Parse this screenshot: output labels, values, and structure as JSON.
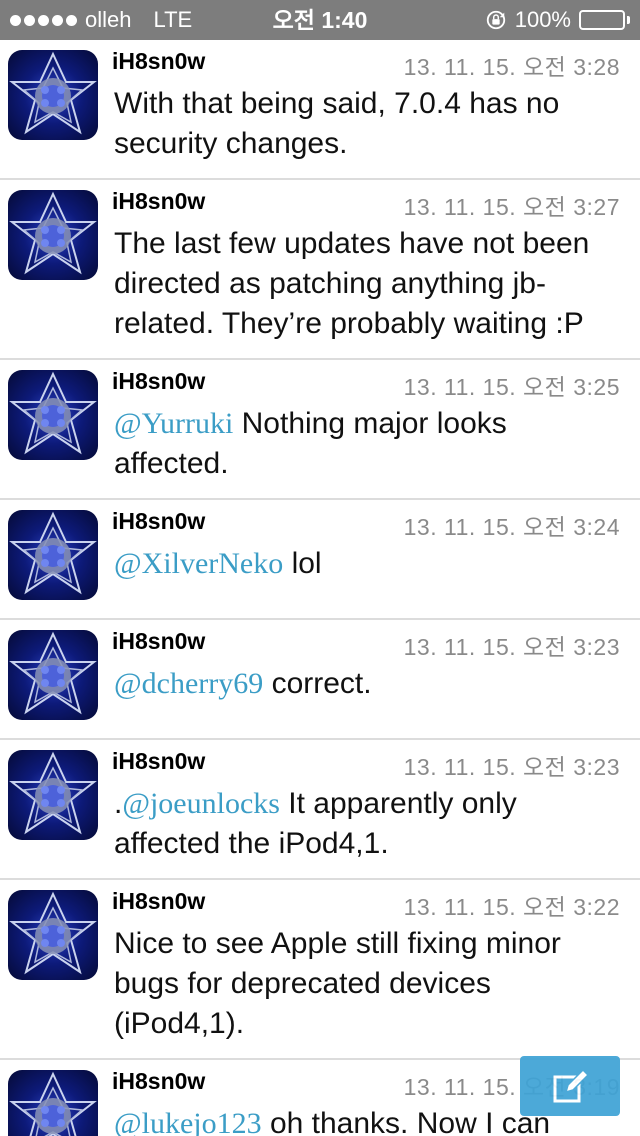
{
  "status_bar": {
    "carrier": "olleh",
    "network": "LTE",
    "time": "오전 1:40",
    "battery": "100%",
    "battery_level": 1.0,
    "signal_bars": 5
  },
  "tweets": [
    {
      "author": "iH8sn0w",
      "timestamp": "13. 11. 15. 오전 3:28",
      "prefix": "",
      "mention": "",
      "text": "With that being said, 7.0.4 has no security changes."
    },
    {
      "author": "iH8sn0w",
      "timestamp": "13. 11. 15. 오전 3:27",
      "prefix": "",
      "mention": "",
      "text": "The last few updates have not been directed as patching anything jb-related. They’re probably waiting :P"
    },
    {
      "author": "iH8sn0w",
      "timestamp": "13. 11. 15. 오전 3:25",
      "prefix": "",
      "mention": "@Yurruki",
      "text": " Nothing major looks affected."
    },
    {
      "author": "iH8sn0w",
      "timestamp": "13. 11. 15. 오전 3:24",
      "prefix": "",
      "mention": "@XilverNeko",
      "text": " lol"
    },
    {
      "author": "iH8sn0w",
      "timestamp": "13. 11. 15. 오전 3:23",
      "prefix": "",
      "mention": "@dcherry69",
      "text": " correct."
    },
    {
      "author": "iH8sn0w",
      "timestamp": "13. 11. 15. 오전 3:23",
      "prefix": ".",
      "mention": "@joeunlocks",
      "text": " It apparently only affected the iPod4,1."
    },
    {
      "author": "iH8sn0w",
      "timestamp": "13. 11. 15. 오전 3:22",
      "prefix": "",
      "mention": "",
      "text": "Nice to see Apple still fixing minor bugs for deprecated devices (iPod4,1)."
    },
    {
      "author": "iH8sn0w",
      "timestamp": "13. 11. 15. 오전 3:19",
      "prefix": "",
      "mention": "@lukejo123",
      "text": " oh thanks. Now I can"
    }
  ],
  "colors": {
    "status_bar": "#7d7d7d",
    "mention": "#3b9dc6",
    "timestamp": "#8a8a8a",
    "compose": "#3fa3d6"
  },
  "icons": {
    "compose": "compose-icon",
    "rotation_lock": "rotation-lock-icon",
    "battery": "battery-icon"
  }
}
